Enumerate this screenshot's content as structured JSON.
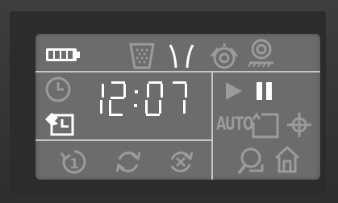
{
  "display": {
    "time": "12:07",
    "mode_label": "AUTO"
  },
  "icons": [
    "battery-icon",
    "dustbin-icon",
    "side-brush-icon",
    "main-brush-icon",
    "filter-icon",
    "clock-icon",
    "schedule-icon",
    "cycle-icon",
    "repeat-icon",
    "cancel-icon",
    "play-icon",
    "pause-icon",
    "spot-clean-icon",
    "target-icon",
    "search-icon",
    "home-icon"
  ],
  "colors": {
    "lcd_background": "#6c6c6c",
    "active_segment": "#ffffff",
    "inactive_segment": "#9b9b9b",
    "frame": "#2c2c2c"
  }
}
